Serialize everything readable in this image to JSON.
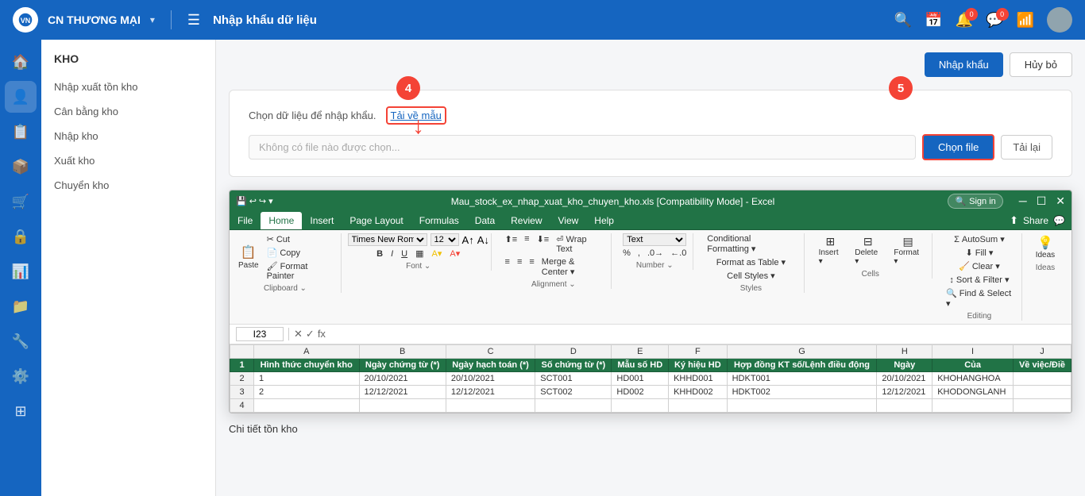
{
  "topNav": {
    "brand": "CN THƯƠNG MẠI",
    "brand_arrow": "▾",
    "title": "Nhập khẩu dữ liệu",
    "icons": {
      "search": "🔍",
      "calendar": "📅",
      "notification_badge": "0",
      "message_badge": "0"
    }
  },
  "sidebar": {
    "icons": [
      "🏠",
      "👤",
      "📋",
      "📦",
      "🛒",
      "🔒",
      "📊",
      "📁",
      "🔧",
      "⚙️",
      "⊞"
    ]
  },
  "leftPanel": {
    "header": "KHO",
    "items": [
      "Nhập xuất tồn kho",
      "Cân bằng kho",
      "Nhập kho",
      "Xuất kho",
      "Chuyển kho"
    ]
  },
  "mainHeader": {
    "import_btn": "Nhập khẩu",
    "cancel_btn": "Hủy bỏ"
  },
  "importCard": {
    "text": "Chọn dữ liệu để nhập khẩu.",
    "link_text": "Tải về mẫu",
    "file_placeholder": "Không có file nào được chọn...",
    "choose_file_btn": "Chọn file",
    "reload_btn": "Tải lại",
    "bubble4": "4",
    "bubble5": "5"
  },
  "excelWindow": {
    "titlebar": {
      "filename": "Mau_stock_ex_nhap_xuat_kho_chuyen_kho.xls [Compatibility Mode] - Excel",
      "search_placeholder": "Sign in",
      "window_controls": [
        "─",
        "☐",
        "✕"
      ]
    },
    "menu_tabs": [
      "File",
      "Home",
      "Insert",
      "Page Layout",
      "Formulas",
      "Data",
      "Review",
      "View",
      "Help"
    ],
    "active_tab": "Home",
    "share_label": "Share",
    "formula_bar": {
      "name_box": "I23",
      "formula_content": ""
    },
    "ribbon": {
      "groups": [
        {
          "label": "Clipboard",
          "items": [
            "Paste",
            "Cut",
            "Copy",
            "Format Painter"
          ]
        },
        {
          "label": "Font",
          "items": [
            "Times New Roma",
            "12",
            "B",
            "I",
            "U"
          ]
        },
        {
          "label": "Alignment",
          "items": [
            "≡",
            "≡",
            "≡",
            "Wrap Text",
            "Merge & Center"
          ]
        },
        {
          "label": "Number",
          "items": [
            "Text",
            "% , .0 .00"
          ]
        },
        {
          "label": "Styles",
          "items": [
            "Conditional Formatting",
            "Format as Table",
            "Cell Styles"
          ]
        },
        {
          "label": "Cells",
          "items": [
            "Insert",
            "Delete",
            "Format"
          ]
        },
        {
          "label": "Editing",
          "items": [
            "AutoSum",
            "Fill",
            "Clear",
            "Sort & Filter",
            "Find & Select"
          ]
        },
        {
          "label": "Ideas",
          "items": [
            "Ideas"
          ]
        }
      ]
    },
    "grid": {
      "col_headers": [
        "",
        "A",
        "B",
        "C",
        "D",
        "E",
        "F",
        "G",
        "H",
        "I",
        "J"
      ],
      "header_row": [
        "Hình thức chuyển kho",
        "Ngày chứng từ (*)",
        "Ngày hạch toán (*)",
        "Số chứng từ (*)",
        "Mẫu số HD",
        "Ký hiệu HD",
        "Hợp đồng KT số/Lệnh điều động",
        "Ngày",
        "Của",
        "Về việc/Điề"
      ],
      "rows": [
        {
          "num": "2",
          "cells": [
            "1",
            "20/10/2021",
            "20/10/2021",
            "SCT001",
            "HD001",
            "KHHD001",
            "HDKT001",
            "20/10/2021",
            "KHOHANGHOA",
            ""
          ]
        },
        {
          "num": "3",
          "cells": [
            "2",
            "12/12/2021",
            "12/12/2021",
            "SCT002",
            "HD002",
            "KHHD002",
            "HDKT002",
            "12/12/2021",
            "KHODONGLANH",
            ""
          ]
        },
        {
          "num": "4",
          "cells": [
            "",
            "",
            "",
            "",
            "",
            "",
            "",
            "",
            "",
            ""
          ]
        }
      ]
    }
  },
  "detailSection": {
    "label": "Chi tiết tồn kho"
  }
}
